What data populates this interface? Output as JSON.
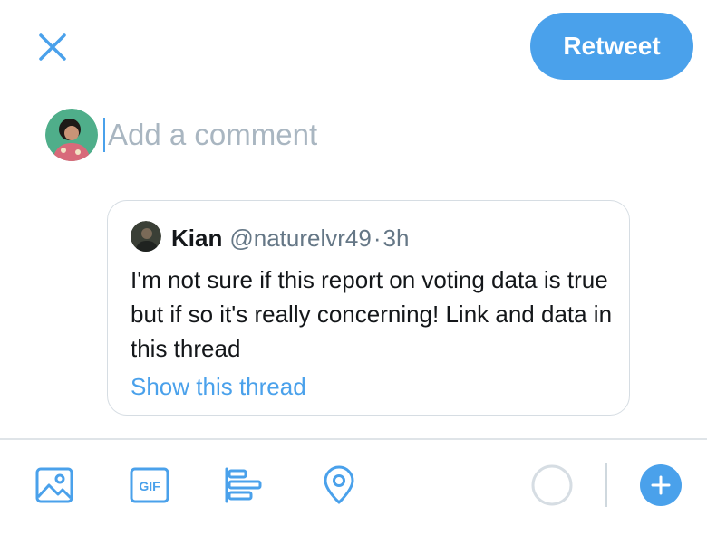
{
  "header": {
    "action_label": "Retweet"
  },
  "compose": {
    "placeholder": "Add a comment"
  },
  "quoted_tweet": {
    "author_name": "Kian",
    "author_handle": "@naturelvr49",
    "separator": "·",
    "time": "3h",
    "text": "I'm not sure if this report on voting data is true but if so it's really concerning! Link and data in this thread",
    "show_thread_label": "Show this thread"
  },
  "toolbar": {
    "items": [
      {
        "icon": "image-icon"
      },
      {
        "icon": "gif-icon",
        "label": "GIF"
      },
      {
        "icon": "poll-icon"
      },
      {
        "icon": "location-icon"
      }
    ],
    "char_counter_progress": 0,
    "add_icon": "plus-icon"
  },
  "colors": {
    "accent": "#4aa1eb",
    "placeholder": "#a9b6c1",
    "text": "#14171a",
    "secondary_text": "#657786",
    "border": "#d6dde3"
  }
}
